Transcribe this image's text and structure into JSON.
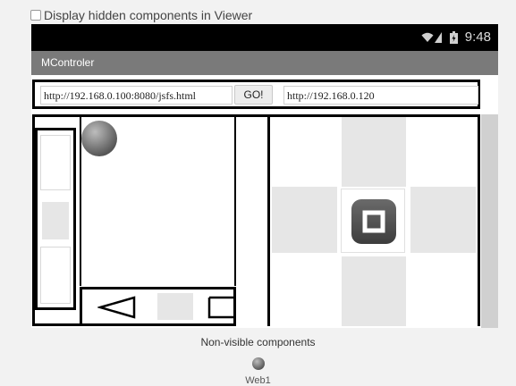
{
  "viewer": {
    "hidden_components_label": "Display hidden components in Viewer",
    "hidden_components_checked": false
  },
  "status_bar": {
    "time": "9:48",
    "icons": [
      "wifi-icon",
      "signal-icon",
      "battery-icon"
    ]
  },
  "app": {
    "title": "MControler"
  },
  "url_row": {
    "left_url": "http://192.168.0.100:8080/jsfs.html",
    "go_label": "GO!",
    "right_url": "http://192.168.0.120"
  },
  "controls": {
    "nav_icons": [
      "triangle-left-icon",
      "square-pad",
      "triangle-right-icon"
    ],
    "dpad_center_icon": "stop-icon"
  },
  "non_visible": {
    "heading": "Non-visible components",
    "components": [
      {
        "name": "Web1",
        "icon": "globe-icon"
      }
    ]
  },
  "colors": {
    "status_bar": "#000000",
    "title_bar": "#7a7a7a",
    "page_bg": "#f2f2f2",
    "pad_gray": "#e6e6e6"
  }
}
